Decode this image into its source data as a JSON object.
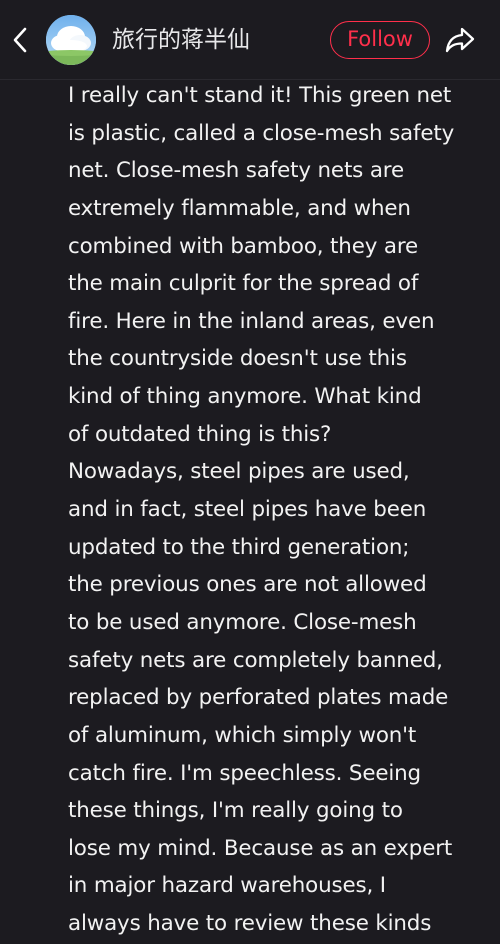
{
  "header": {
    "username": "旅行的蒋半仙",
    "follow_label": "Follow",
    "back_icon": "chevron-left-icon",
    "share_icon": "share-arrow-icon",
    "avatar": "avatar-sky-cloud",
    "accent_color": "#ff2f4b",
    "background_color": "#1c1b20"
  },
  "post": {
    "lines": [
      "I really can't stand it! This green net",
      "is plastic, called a close-mesh safety",
      "net. Close-mesh safety nets are",
      "extremely flammable, and when",
      "combined with bamboo, they are",
      "the main culprit for the spread of",
      "fire. Here in the inland areas, even",
      "the countryside doesn't use this",
      "kind of thing anymore. What kind",
      "of outdated thing is this?",
      "Nowadays, steel pipes are used,",
      "and in fact, steel pipes have been",
      "updated to the third generation;",
      "the previous ones are not allowed",
      "to be used anymore. Close-mesh",
      "safety nets are completely banned,",
      "replaced by perforated plates made",
      "of aluminum, which simply won't",
      "catch fire. I'm speechless. Seeing",
      "these things, I'm really going to",
      "lose my mind. Because as an expert",
      "in major hazard warehouses, I",
      "always have to review these kinds"
    ]
  }
}
